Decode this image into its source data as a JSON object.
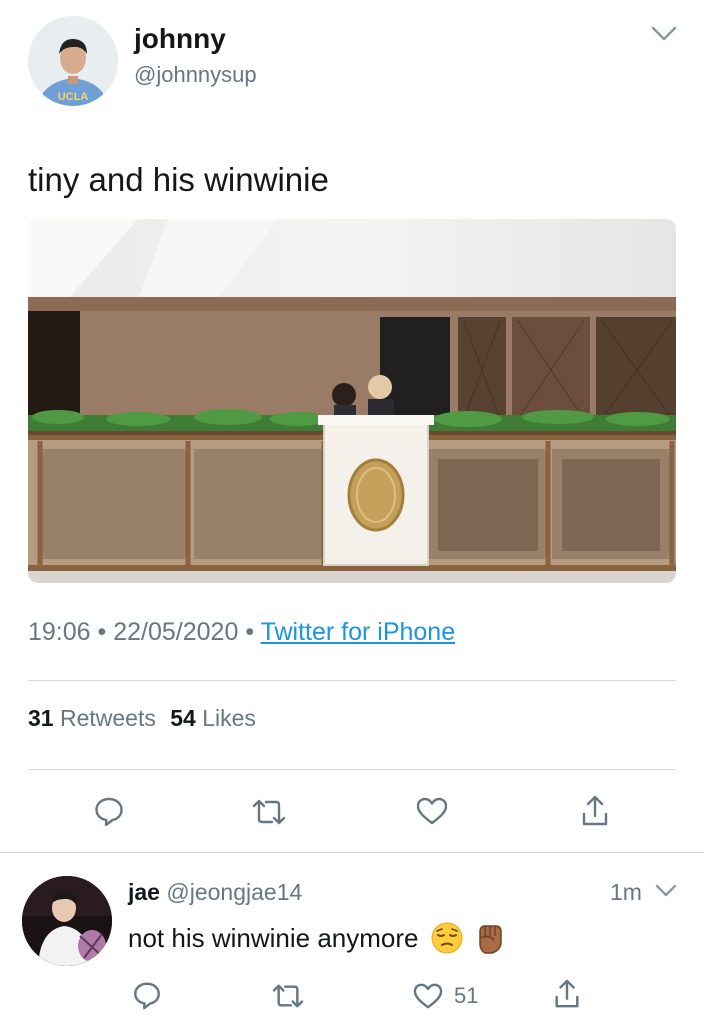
{
  "main_tweet": {
    "author": {
      "display_name": "johnny",
      "handle": "@johnnysup",
      "avatar_shirt_text": "UCLA"
    },
    "text": "tiny and his winwinie",
    "meta": {
      "time": "19:06",
      "date": "22/05/2020",
      "client": "Twitter for iPhone",
      "separator": "•"
    },
    "stats": {
      "retweets_count": "31",
      "retweets_label": "Retweets",
      "likes_count": "54",
      "likes_label": "Likes"
    },
    "actions": [
      "reply-icon",
      "retweet-icon",
      "like-icon",
      "share-icon"
    ]
  },
  "reply": {
    "author": {
      "display_name": "jae",
      "handle": "@jeongjae14"
    },
    "timestamp": "1m",
    "text": "not his winwinie anymore",
    "emojis": [
      "pensive-face-emoji",
      "raised-fist-emoji"
    ],
    "like_count": "51",
    "actions": [
      "reply-icon",
      "retweet-icon",
      "like-icon",
      "share-icon"
    ]
  },
  "colors": {
    "text_primary": "#14171a",
    "text_secondary": "#657786",
    "link": "#1b95e0",
    "divider": "#d6dbdf"
  }
}
